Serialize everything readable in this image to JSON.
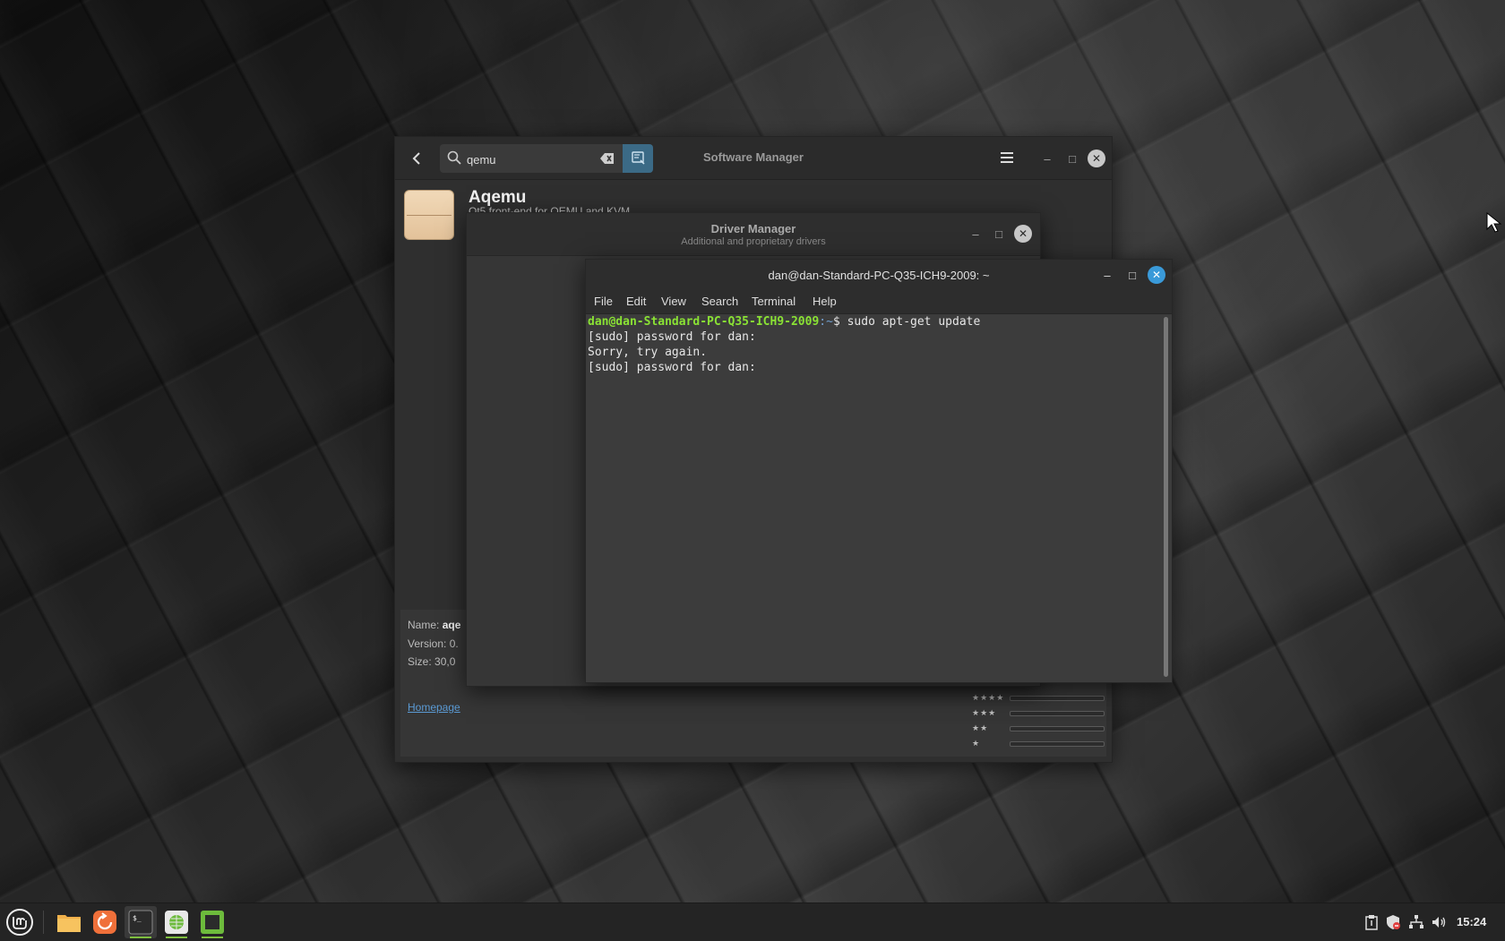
{
  "software_manager": {
    "title": "Software Manager",
    "search_value": "qemu",
    "app_name": "Aqemu",
    "app_description": "Qt5 front-end for QEMU and KVM",
    "details": {
      "name_label": "Name:",
      "name_value": "aqe",
      "version_label": "Version:",
      "version_value": "0.",
      "size_label": "Size:",
      "size_value": "30,0",
      "homepage_label": "Homepage"
    },
    "ratings": [
      "★★★★",
      "★★★",
      "★★",
      "★"
    ]
  },
  "driver_manager": {
    "title": "Driver Manager",
    "subtitle": "Additional and proprietary drivers"
  },
  "terminal": {
    "title": "dan@dan-Standard-PC-Q35-ICH9-2009: ~",
    "menu": [
      "File",
      "Edit",
      "View",
      "Search",
      "Terminal",
      "Help"
    ],
    "prompt_user": "dan@dan-Standard-PC-Q35-ICH9-2009",
    "prompt_path": ":~",
    "prompt_symbol": "$ ",
    "command": "sudo apt-get update",
    "output_lines": [
      "[sudo] password for dan:",
      "Sorry, try again.",
      "[sudo] password for dan:"
    ]
  },
  "taskbar": {
    "clock": "15:24",
    "icons": [
      "mint-menu-icon",
      "files-icon",
      "firefox-icon",
      "terminal-icon",
      "network-globe-icon",
      "green-app-icon"
    ]
  },
  "colors": {
    "prompt_green": "#8ae234",
    "prompt_blue": "#729fcf",
    "accent_blue": "#3a9ad9",
    "taskbar_indicator": "#7fbf3f"
  }
}
